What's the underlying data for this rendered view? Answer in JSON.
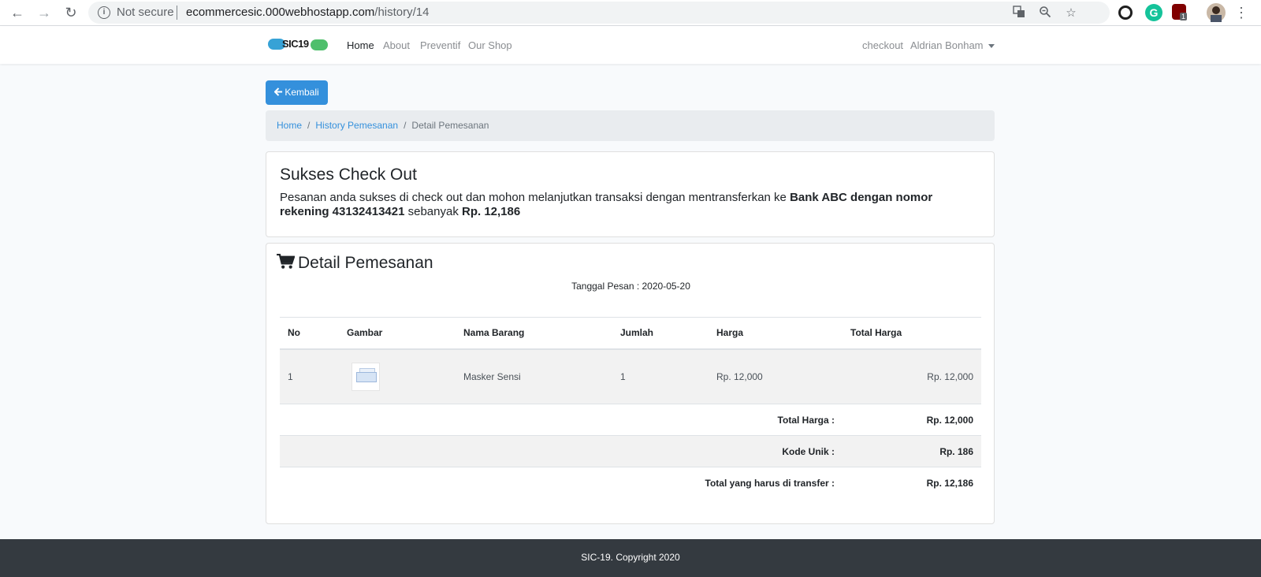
{
  "browser": {
    "security_text": "Not secure",
    "url_host": "ecommercesic.000webhostapp.com",
    "url_path": "/history/14",
    "ext_badge": "1"
  },
  "navbar": {
    "brand": "SIC19",
    "links": [
      "Home",
      "About",
      "Preventif",
      "Our Shop"
    ],
    "checkout": "checkout",
    "user": "Aldrian Bonham"
  },
  "back_button": "Kembali",
  "breadcrumb": [
    "Home",
    "History Pemesanan",
    "Detail Pemesanan"
  ],
  "success": {
    "title": "Sukses Check Out",
    "text_pre": "Pesanan anda sukses di check out dan mohon melanjutkan transaksi dengan mentransferkan ke ",
    "bank": "Bank ABC dengan nomor rekening 43132413421",
    "text_mid": " sebanyak ",
    "amount": "Rp. 12,186"
  },
  "order": {
    "title": "Detail Pemesanan",
    "date_label": "Tanggal Pesan : 2020-05-20",
    "columns": [
      "No",
      "Gambar",
      "Nama Barang",
      "Jumlah",
      "Harga",
      "Total Harga"
    ],
    "rows": [
      {
        "no": "1",
        "name": "Masker Sensi",
        "qty": "1",
        "price": "Rp. 12,000",
        "total": "Rp. 12,000"
      }
    ],
    "summary": [
      {
        "label": "Total Harga :",
        "value": "Rp. 12,000"
      },
      {
        "label": "Kode Unik :",
        "value": "Rp. 186"
      },
      {
        "label": "Total yang harus di transfer :",
        "value": "Rp. 12,186"
      }
    ]
  },
  "footer": "SIC-19. Copyright 2020",
  "colors": {
    "primary": "#3490dc",
    "footer_bg": "#343a40",
    "breadcrumb_bg": "#e9ecef"
  }
}
